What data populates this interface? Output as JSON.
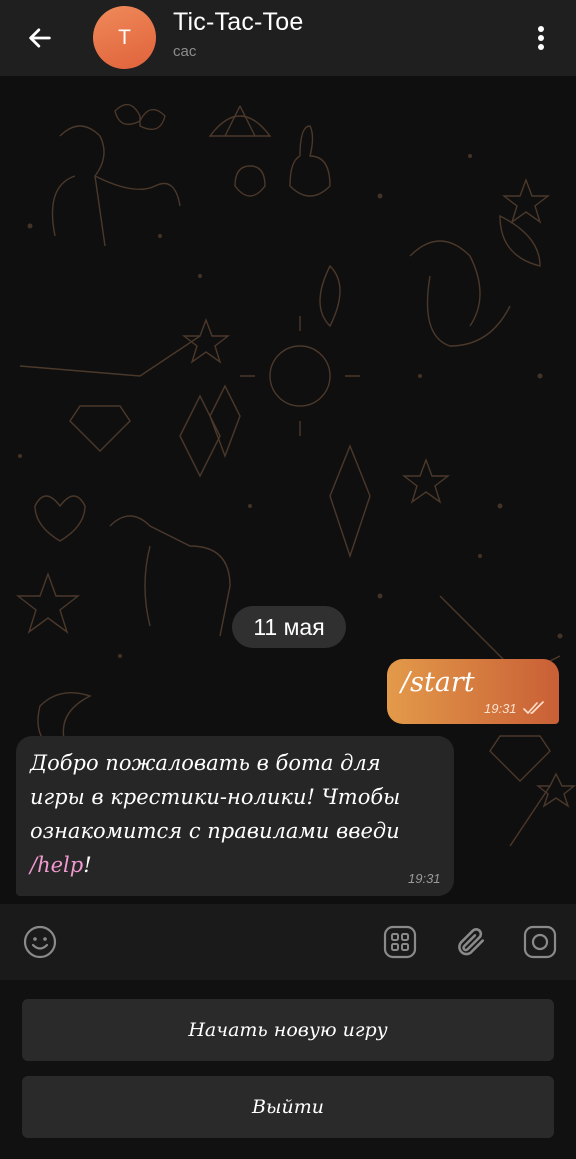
{
  "header": {
    "back_icon": "arrow-left-icon",
    "avatar_letter": "T",
    "avatar_color": "#e8704a",
    "title": "Tic-Tac-Toe",
    "subtitle": "сас",
    "menu_icon": "more-vertical-icon"
  },
  "chat": {
    "date_chip": "11 мая",
    "messages": [
      {
        "direction": "outgoing",
        "text": "/start",
        "time": "19:31",
        "status": "read"
      },
      {
        "direction": "incoming",
        "text_before": "Добро пожаловать в бота для игры в крестики-нолики! Чтобы ознакомится с правилами введи ",
        "command": "/help",
        "text_after": "!",
        "time": "19:31"
      }
    ]
  },
  "input_bar": {
    "emoji_icon": "emoji-icon",
    "placeholder": "",
    "keyboard_icon": "bot-keyboard-icon",
    "attach_icon": "paperclip-icon",
    "camera_icon": "camera-icon"
  },
  "keyboard": {
    "buttons": [
      {
        "label": "Начать новую игру"
      },
      {
        "label": "Выйти"
      }
    ]
  },
  "colors": {
    "accent": "#e08a47",
    "bubble_out_start": "#e39a4a",
    "bubble_out_end": "#c95f36",
    "bubble_in": "#262626",
    "command_link": "#f19ad1"
  }
}
